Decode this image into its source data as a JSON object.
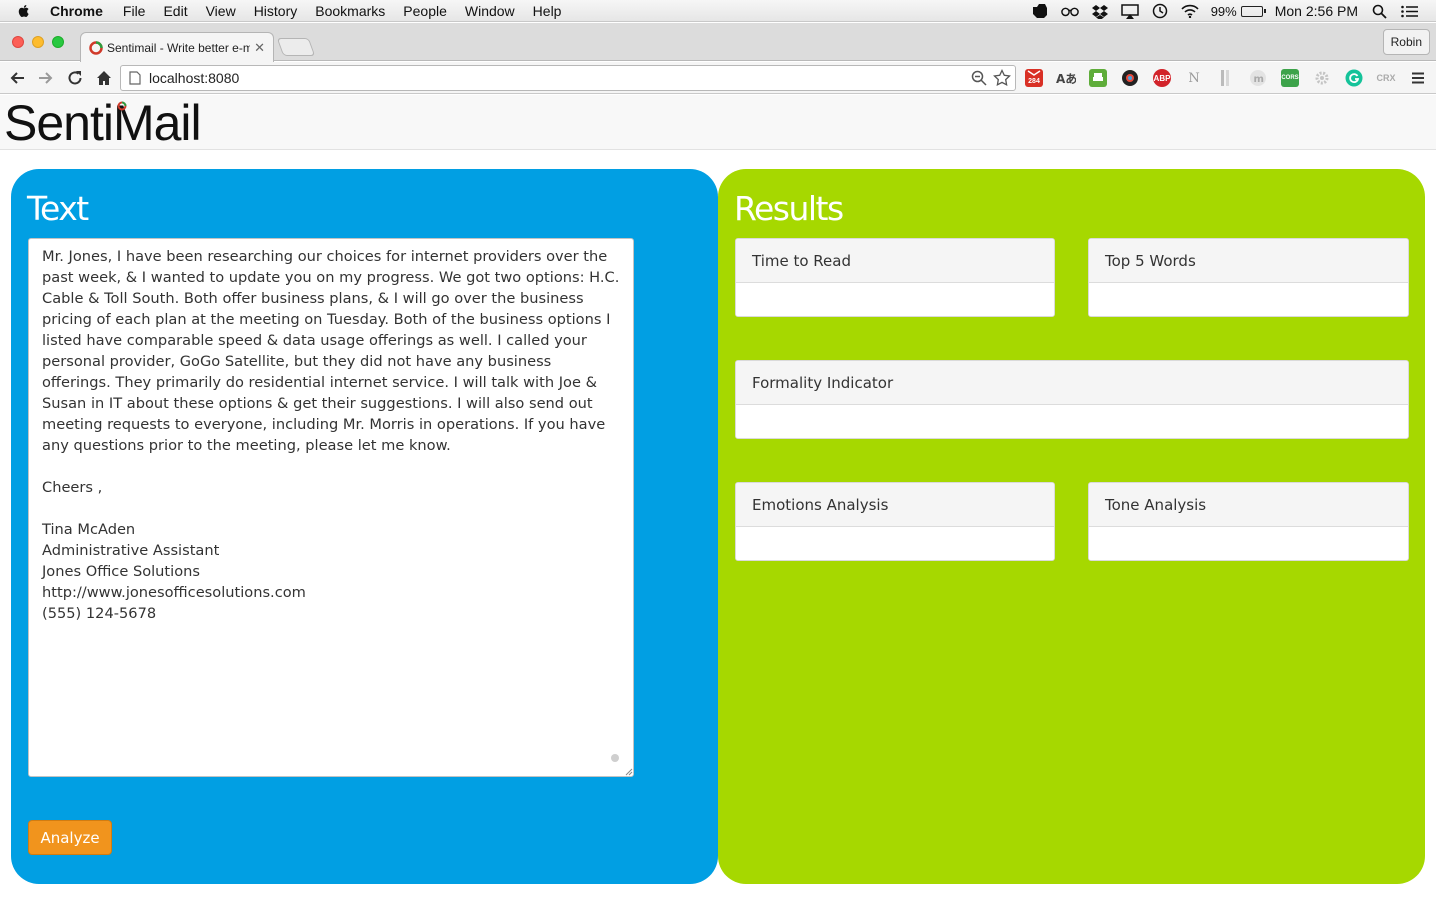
{
  "menubar": {
    "app_name": "Chrome",
    "items": [
      "File",
      "Edit",
      "View",
      "History",
      "Bookmarks",
      "People",
      "Window",
      "Help"
    ],
    "battery": "99%",
    "clock": "Mon 2:56 PM"
  },
  "browser": {
    "tab_title": "Sentimail - Write better e-m",
    "profile": "Robin",
    "url": "localhost:8080",
    "gmail_badge": "284",
    "extensions": [
      "ABP",
      "N",
      "CORS",
      "CRX"
    ]
  },
  "app": {
    "logo": "SentiMail",
    "text_panel": {
      "title": "Text",
      "email_body": "Mr. Jones, I have been researching our choices for internet providers over the past week, & I wanted to update you on my progress. We got two options: H.C. Cable & Toll South. Both offer business plans, & I will go over the business pricing of each plan at the meeting on Tuesday. Both of the business options I listed have comparable speed & data usage offerings as well. I called your personal provider, GoGo Satellite, but they did not have any business offerings. They primarily do residential internet service. I will talk with Joe & Susan in IT about these options & get their suggestions. I will also send out meeting requests to everyone, including Mr. Morris in operations. If you have any questions prior to the meeting, please let me know.\n\nCheers ,\n\nTina McAden\nAdministrative Assistant\nJones Office Solutions\nhttp://www.jonesofficesolutions.com\n(555) 124-5678",
      "analyze_label": "Analyze"
    },
    "results_panel": {
      "title": "Results",
      "cards": {
        "time_to_read": "Time to Read",
        "top_words": "Top 5 Words",
        "formality": "Formality Indicator",
        "emotions": "Emotions Analysis",
        "tone": "Tone Analysis"
      }
    }
  },
  "colors": {
    "text_panel_bg": "#019fe3",
    "results_panel_bg": "#a6d800",
    "analyze_button": "#f1941d"
  }
}
